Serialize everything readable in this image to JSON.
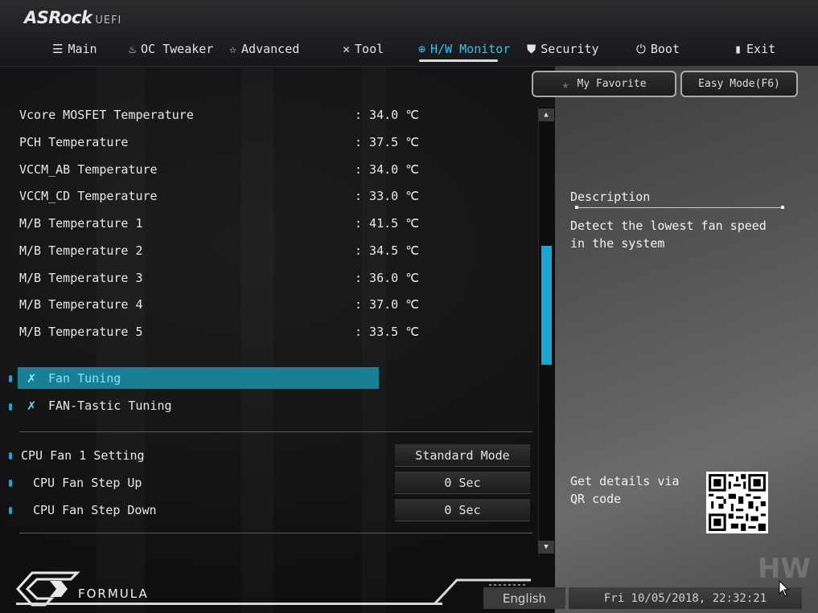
{
  "brand": {
    "name": "ASRock",
    "suffix": "UEFI"
  },
  "tabs": [
    {
      "label": "Main",
      "icon": "list-icon"
    },
    {
      "label": "OC Tweaker",
      "icon": "flame-icon"
    },
    {
      "label": "Advanced",
      "icon": "star-advanced-icon"
    },
    {
      "label": "Tool",
      "icon": "tools-icon"
    },
    {
      "label": "H/W Monitor",
      "icon": "monitor-icon",
      "active": true
    },
    {
      "label": "Security",
      "icon": "shield-icon"
    },
    {
      "label": "Boot",
      "icon": "power-icon"
    },
    {
      "label": "Exit",
      "icon": "exit-icon"
    }
  ],
  "buttons": {
    "favorite": "My Favorite",
    "easy_mode": "Easy Mode(F6)"
  },
  "temperatures": [
    {
      "label": "Vcore MOSFET Temperature",
      "value": ": 34.0 ℃"
    },
    {
      "label": "PCH Temperature",
      "value": ": 37.5 ℃"
    },
    {
      "label": "VCCM_AB Temperature",
      "value": ": 34.0 ℃"
    },
    {
      "label": "VCCM_CD Temperature",
      "value": ": 33.0 ℃"
    },
    {
      "label": "M/B Temperature 1",
      "value": ": 41.5 ℃"
    },
    {
      "label": "M/B Temperature 2",
      "value": ": 34.5 ℃"
    },
    {
      "label": "M/B Temperature 3",
      "value": ": 36.0 ℃"
    },
    {
      "label": "M/B Temperature 4",
      "value": ": 37.0 ℃"
    },
    {
      "label": "M/B Temperature 5",
      "value": ": 33.5 ℃"
    }
  ],
  "menu_items": [
    {
      "label": "Fan Tuning",
      "selected": true
    },
    {
      "label": "FAN-Tastic Tuning",
      "selected": false
    }
  ],
  "fan_settings": [
    {
      "label": "CPU Fan 1 Setting",
      "value": "Standard Mode"
    },
    {
      "label": "CPU Fan Step Up",
      "value": "0 Sec"
    },
    {
      "label": "CPU Fan Step Down",
      "value": "0 Sec"
    }
  ],
  "description": {
    "title": "Description",
    "text": "Detect the lowest fan speed in the system",
    "qr_text": "Get details via QR code"
  },
  "footer": {
    "brand": "FORMULA",
    "language": "English",
    "datetime": "Fri 10/05/2018, 22:32:21"
  },
  "colors": {
    "accent": "#1aa6cf",
    "selected_row": "#1a7e94",
    "active_tab": "#2fc4e8"
  }
}
